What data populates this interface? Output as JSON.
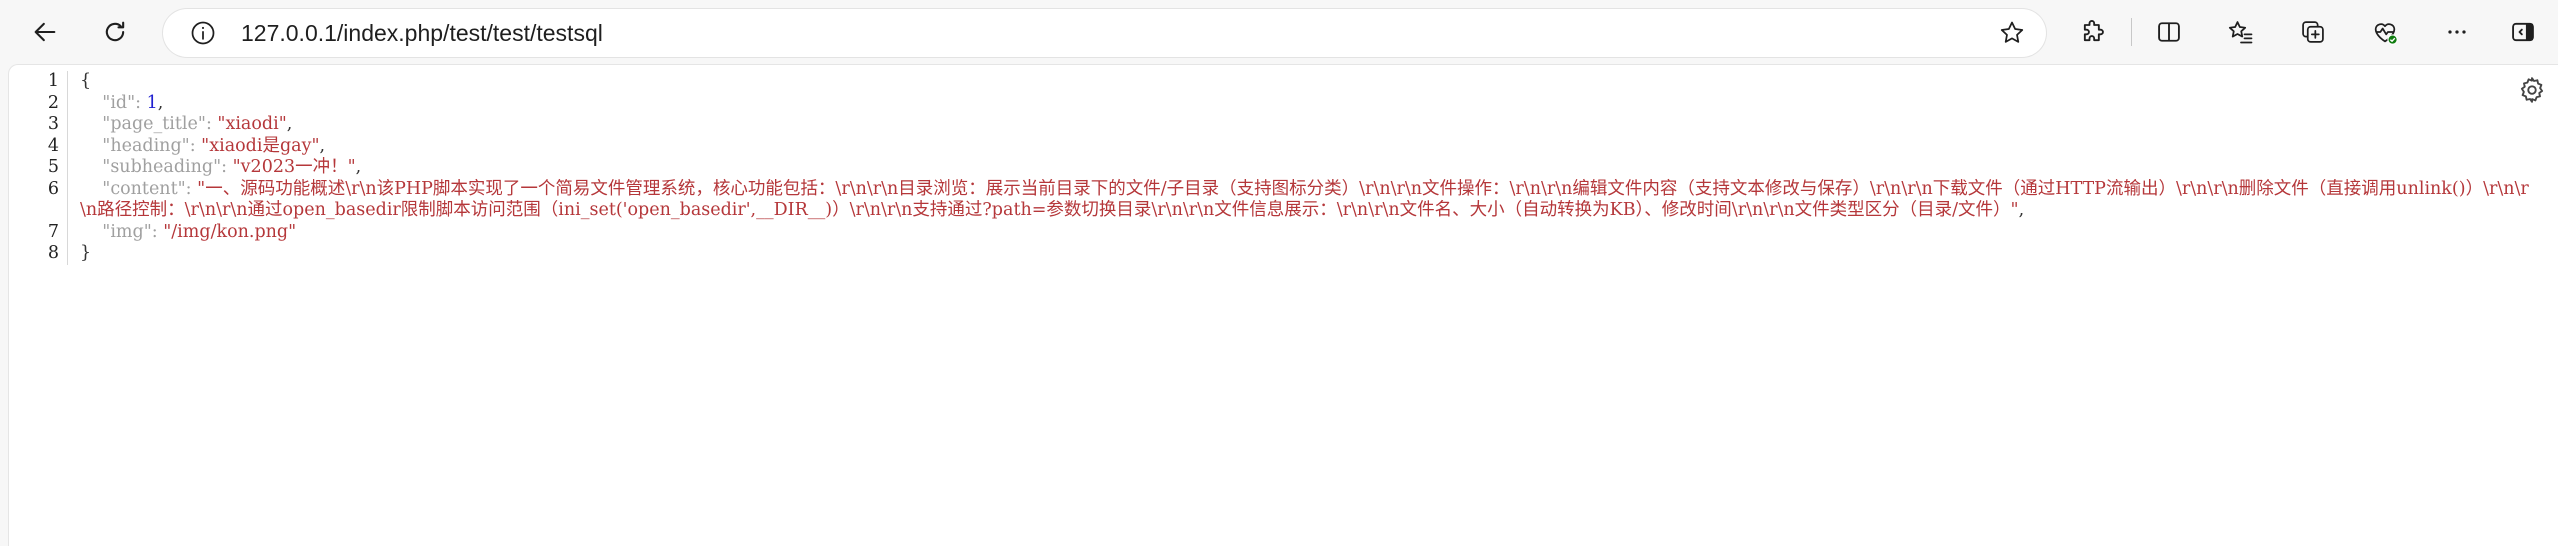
{
  "browser": {
    "url": "127.0.0.1/index.php/test/test/testsql",
    "icons": {
      "back": "back-arrow-icon",
      "refresh": "refresh-icon",
      "site_info": "info-icon",
      "favorite": "star-icon",
      "extensions": "puzzle-icon",
      "split_screen": "split-screen-icon",
      "favorites": "favorites-list-icon",
      "collections": "collections-icon",
      "browser_essentials": "heart-pulse-icon",
      "more": "more-icon",
      "sidebar": "sidebar-icon"
    }
  },
  "viewer": {
    "settings_icon": "gear-icon",
    "lines": [
      {
        "num": "1",
        "open": "{"
      },
      {
        "num": "2",
        "indent": "    ",
        "key": "\"id\"",
        "colon": ": ",
        "value_number": "1",
        "comma": ","
      },
      {
        "num": "3",
        "indent": "    ",
        "key": "\"page_title\"",
        "colon": ": ",
        "value": "\"xiaodi\"",
        "comma": ","
      },
      {
        "num": "4",
        "indent": "    ",
        "key": "\"heading\"",
        "colon": ": ",
        "value": "\"xiaodi是gay\"",
        "comma": ","
      },
      {
        "num": "5",
        "indent": "    ",
        "key": "\"subheading\"",
        "colon": ": ",
        "value": "\"v2023一冲！\"",
        "comma": ","
      },
      {
        "num": "6",
        "indent": "    ",
        "key": "\"content\"",
        "colon": ": ",
        "value": "\"一、源码功能概述\\r\\n该PHP脚本实现了一个简易文件管理系统，核心功能包括：\\r\\n\\r\\n目录浏览：展示当前目录下的文件/子目录（支持图标分类）\\r\\n\\r\\n文件操作：\\r\\n\\r\\n编辑文件内容（支持文本修改与保存）\\r\\n\\r\\n下载文件（通过HTTP流输出）\\r\\n\\r\\n删除文件（直接调用unlink()）\\r\\n\\r\\n路径控制：\\r\\n\\r\\n通过open_basedir限制脚本访问范围（ini_set('open_basedir',__DIR__)）\\r\\n\\r\\n支持通过?path=参数切换目录\\r\\n\\r\\n文件信息展示：\\r\\n\\r\\n文件名、大小（自动转换为KB）、修改时间\\r\\n\\r\\n文件类型区分（目录/文件）\"",
        "comma": ","
      },
      {
        "num": "7",
        "indent": "    ",
        "key": "\"img\"",
        "colon": ": ",
        "value": "\"/img/kon.png\"",
        "comma": ""
      },
      {
        "num": "8",
        "open": "}"
      }
    ]
  }
}
